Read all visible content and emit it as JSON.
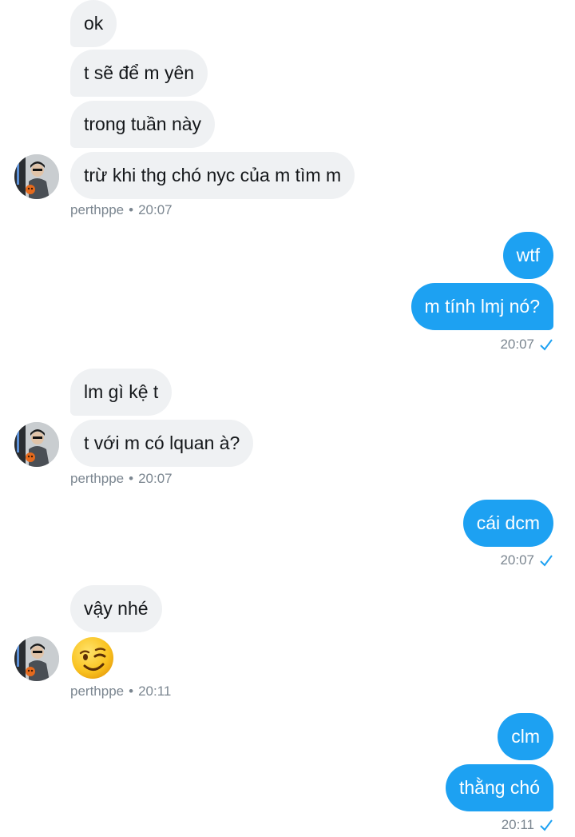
{
  "incoming_group_1": {
    "messages": [
      "ok",
      "t sẽ để m yên",
      "trong tuần này",
      "trừ khi thg chó nyc của m tìm m"
    ],
    "sender": "perthppe",
    "time": "20:07"
  },
  "outgoing_group_1": {
    "messages": [
      "wtf",
      "m tính lmj nó?"
    ],
    "time": "20:07"
  },
  "incoming_group_2": {
    "messages": [
      "lm gì kệ t",
      "t với m có lquan à?"
    ],
    "sender": "perthppe",
    "time": "20:07"
  },
  "outgoing_group_2": {
    "messages": [
      "cái dcm"
    ],
    "time": "20:07"
  },
  "incoming_group_3": {
    "messages": [
      "vậy nhé"
    ],
    "emoji": "winking-face",
    "sender": "perthppe",
    "time": "20:11"
  },
  "outgoing_group_3": {
    "messages": [
      "clm",
      "thằng chó"
    ],
    "time": "20:11"
  },
  "colors": {
    "outgoing_bubble": "#1da1f2",
    "incoming_bubble": "#eff1f3",
    "meta_text": "#7b8690"
  },
  "separator": "•"
}
